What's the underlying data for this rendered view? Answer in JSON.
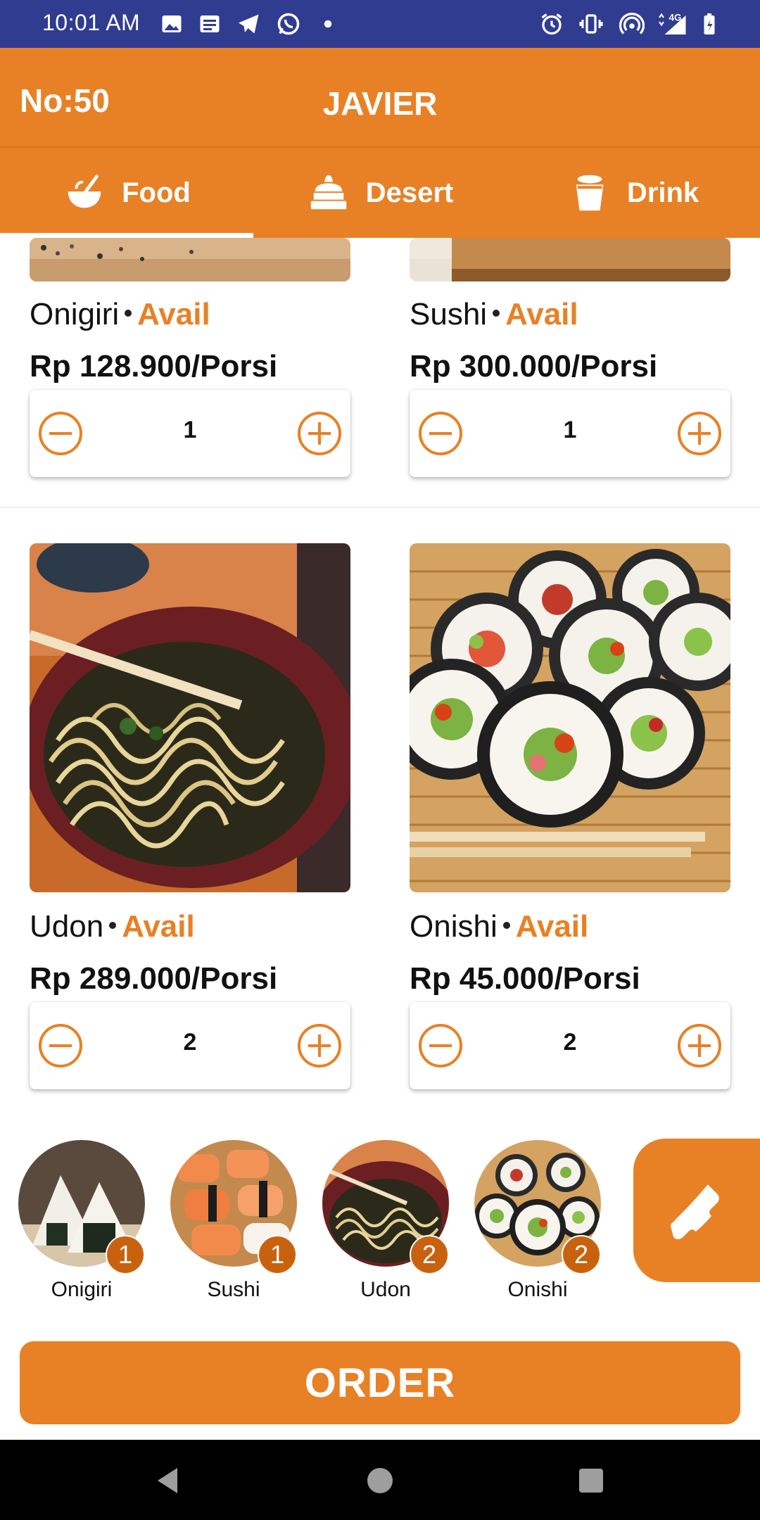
{
  "status_bar": {
    "time": "10:01 AM",
    "left_icons": [
      "image-icon",
      "news-icon",
      "telegram-icon",
      "whatsapp-icon",
      "dot-icon"
    ],
    "right_icons": [
      "alarm-icon",
      "vibrate-icon",
      "hotspot-icon",
      "signal-4g-icon",
      "battery-icon"
    ],
    "network": "4G"
  },
  "header": {
    "table_no": "No:50",
    "title": "JAVIER"
  },
  "tabs": [
    {
      "label": "Food",
      "icon": "bowl-icon",
      "active": true
    },
    {
      "label": "Desert",
      "icon": "cake-icon",
      "active": false
    },
    {
      "label": "Drink",
      "icon": "cup-icon",
      "active": false
    }
  ],
  "menu_items": [
    {
      "name": "Onigiri",
      "status": "Avail",
      "price": "Rp 128.900/Porsi",
      "qty": "1",
      "image": "onigiri-photo"
    },
    {
      "name": "Sushi",
      "status": "Avail",
      "price": "Rp 300.000/Porsi",
      "qty": "1",
      "image": "sushi-photo"
    },
    {
      "name": "Udon",
      "status": "Avail",
      "price": "Rp 289.000/Porsi",
      "qty": "2",
      "image": "udon-photo"
    },
    {
      "name": "Onishi",
      "status": "Avail",
      "price": "Rp 45.000/Porsi",
      "qty": "2",
      "image": "onishi-photo"
    }
  ],
  "cart": [
    {
      "name": "Onigiri",
      "count": "1"
    },
    {
      "name": "Sushi",
      "count": "1"
    },
    {
      "name": "Udon",
      "count": "2"
    },
    {
      "name": "Onishi",
      "count": "2"
    }
  ],
  "call_button": {
    "icon": "phone-icon"
  },
  "order_button": {
    "label": "ORDER"
  },
  "colors": {
    "primary": "#e88125",
    "badge": "#c9620f",
    "status_bar": "#2f3c8f"
  }
}
